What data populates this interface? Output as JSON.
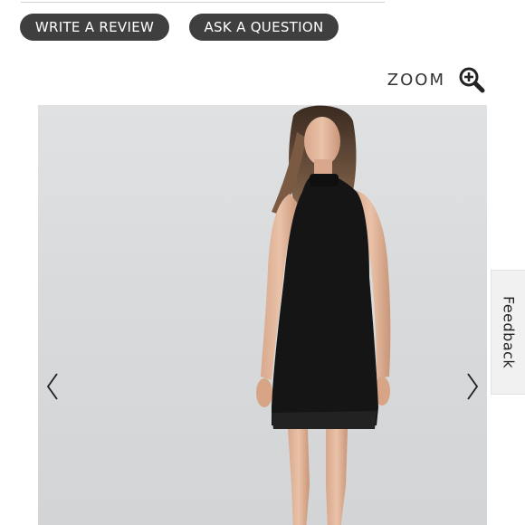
{
  "actions": {
    "write_review_label": "WRITE A REVIEW",
    "ask_question_label": "ASK A QUESTION"
  },
  "zoom": {
    "label": "ZOOM",
    "icon": "zoom-in-magnifier-icon"
  },
  "gallery": {
    "image": "model wearing black halter dress",
    "prev_icon": "chevron-left-icon",
    "next_icon": "chevron-right-icon",
    "background_color": "#d9dbdd",
    "dress_color": "#151515"
  },
  "feedback": {
    "label": "Feedback"
  },
  "colors": {
    "button_bg": "#3f3f3f",
    "button_text": "#ffffff",
    "text_dark": "#333333"
  }
}
